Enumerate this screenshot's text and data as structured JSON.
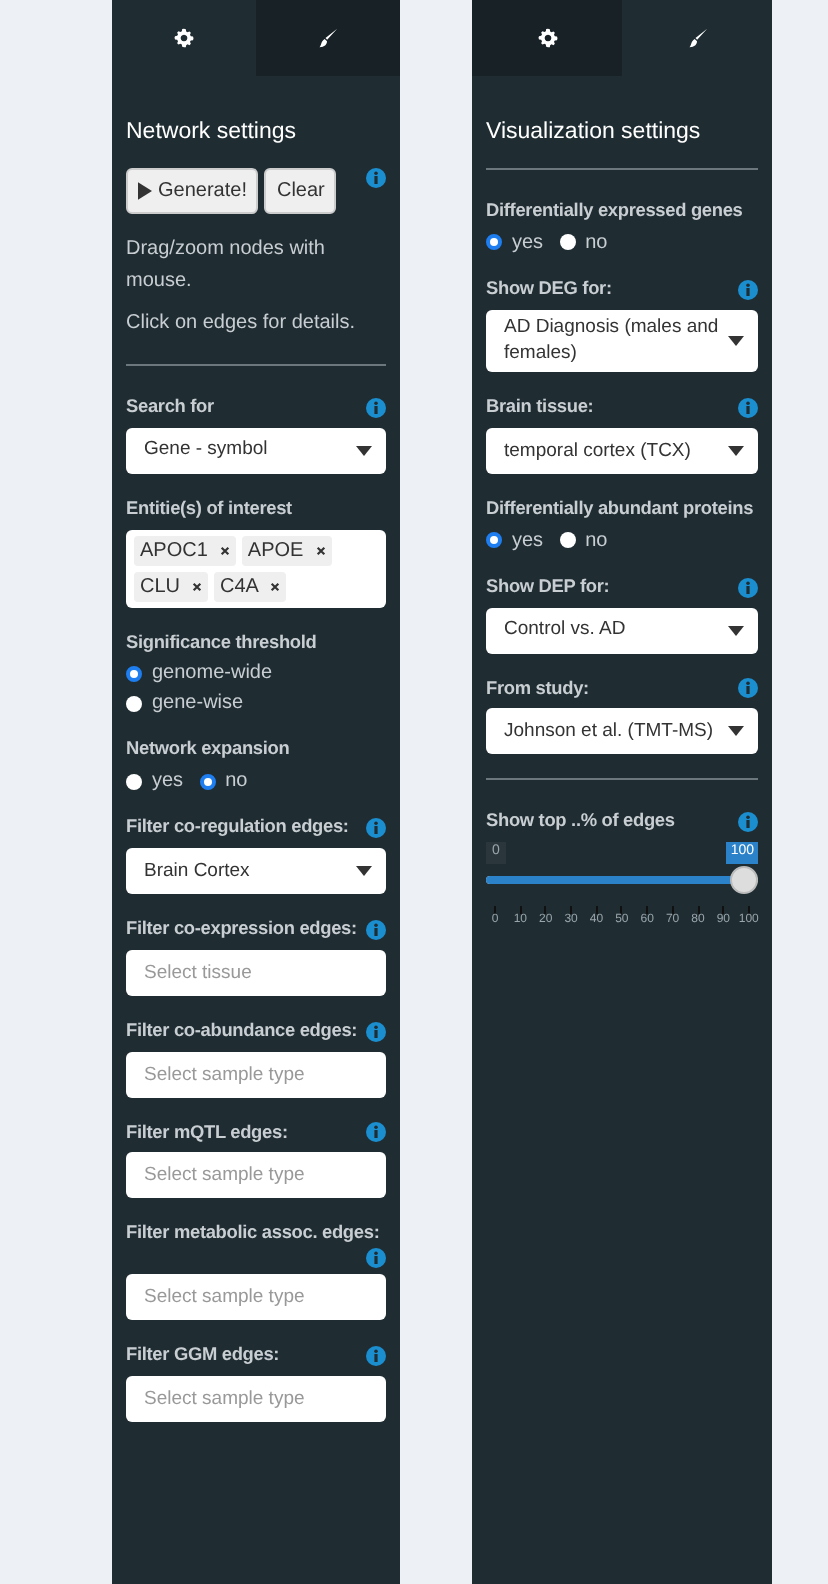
{
  "panels": [
    {
      "tabs": [
        {
          "kind": "gear",
          "selected": true
        },
        {
          "kind": "brush",
          "selected": false
        }
      ],
      "title": "Network settings",
      "items": [
        {
          "kind": "buttons",
          "info": true,
          "buttons": [
            {
              "label": "Generate!",
              "kind": "play"
            },
            {
              "label": "Clear"
            }
          ]
        },
        {
          "kind": "text",
          "text": "Drag/zoom nodes with mouse."
        },
        {
          "kind": "text",
          "text": "Click on edges for details."
        },
        {
          "kind": "divider"
        },
        {
          "kind": "select",
          "label": "Search for",
          "info": true,
          "value": "Gene - symbol"
        },
        {
          "kind": "tags",
          "label": "Entitie(s) of interest",
          "tags": [
            "APOC1",
            "APOE",
            "CLU",
            "C4A"
          ]
        },
        {
          "kind": "radio",
          "label": "Significance threshold",
          "inline": false,
          "options": [
            {
              "label": "genome-wide",
              "selected": true
            },
            {
              "label": "gene-wise",
              "selected": false
            }
          ]
        },
        {
          "kind": "radio",
          "label": "Network expansion",
          "inline": true,
          "options": [
            {
              "label": "yes",
              "selected": false
            },
            {
              "label": "no",
              "selected": true
            }
          ]
        },
        {
          "kind": "select",
          "label": "Filter co-regulation edges:",
          "info": true,
          "value": "Brain Cortex"
        },
        {
          "kind": "field",
          "label": "Filter co-expression edges:",
          "info": true,
          "placeholder": "Select tissue"
        },
        {
          "kind": "field",
          "label": "Filter co-abundance edges:",
          "info": true,
          "placeholder": "Select sample type"
        },
        {
          "kind": "field",
          "label": "Filter mQTL edges:",
          "info": true,
          "placeholder": "Select sample type"
        },
        {
          "kind": "field",
          "label": "Filter metabolic assoc. edges:",
          "info": true,
          "placeholder": "Select sample type"
        },
        {
          "kind": "field",
          "label": "Filter GGM edges:",
          "info": true,
          "placeholder": "Select sample type"
        }
      ]
    },
    {
      "tabs": [
        {
          "kind": "gear",
          "selected": false
        },
        {
          "kind": "brush",
          "selected": true
        }
      ],
      "title": "Visualization settings",
      "items": [
        {
          "kind": "divider"
        },
        {
          "kind": "radio",
          "label": "Differentially expressed genes",
          "inline": true,
          "options": [
            {
              "label": "yes",
              "selected": true
            },
            {
              "label": "no",
              "selected": false
            }
          ]
        },
        {
          "kind": "select",
          "label": "Show DEG for:",
          "info": true,
          "value": "AD Diagnosis (males and females)"
        },
        {
          "kind": "select",
          "label": "Brain tissue:",
          "info": true,
          "value": "temporal cortex (TCX)"
        },
        {
          "kind": "radio",
          "label": "Differentially abundant proteins",
          "inline": true,
          "options": [
            {
              "label": "yes",
              "selected": true
            },
            {
              "label": "no",
              "selected": false
            }
          ]
        },
        {
          "kind": "select",
          "label": "Show DEP for:",
          "info": true,
          "value": "Control vs. AD"
        },
        {
          "kind": "select",
          "label": "From study:",
          "info": true,
          "value": "Johnson et al. (TMT-MS)"
        },
        {
          "kind": "divider"
        },
        {
          "kind": "slider",
          "label": "Show top ..% of edges",
          "info": true,
          "min": "0",
          "value": "100",
          "level": 1,
          "ticks": [
            "0",
            "10",
            "20",
            "30",
            "40",
            "50",
            "60",
            "70",
            "80",
            "90",
            "100"
          ]
        }
      ]
    }
  ]
}
